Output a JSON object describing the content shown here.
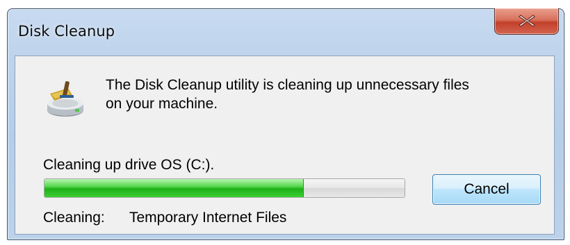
{
  "window": {
    "title": "Disk Cleanup",
    "close_icon": "close-x-icon"
  },
  "dialog": {
    "app_icon": "disk-cleanup-broom-icon",
    "message": "The Disk Cleanup utility is cleaning up unnecessary files\non your machine.",
    "progress_label": "Cleaning up drive OS (C:).",
    "progress": {
      "percent": 72,
      "fill_color": "#2bbf24"
    },
    "cancel_label": "Cancel",
    "status_key": "Cleaning:",
    "status_value": "Temporary Internet Files"
  },
  "colors": {
    "title_bar": "#bfd4ec",
    "close_button": "#c7442e",
    "client_background": "#f0f0f0",
    "button_border": "#3c7fb1"
  }
}
